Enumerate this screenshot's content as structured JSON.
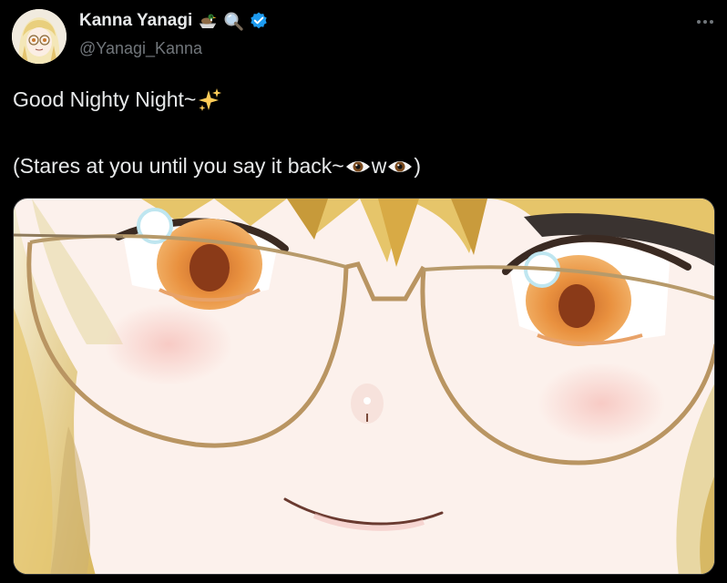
{
  "author": {
    "display_name": "Kanna Yanagi",
    "handle": "@Yanagi_Kanna",
    "name_emojis": [
      "duck-boat-emoji",
      "magnifying-glass-emoji"
    ],
    "verified": true,
    "verified_color": "#1d9bf0"
  },
  "tweet": {
    "line1_text": "Good Nighty Night~",
    "line1_emoji": "sparkles-emoji",
    "line2_prefix": "(Stares at you until you say it back~",
    "line2_mid": "w",
    "line2_suffix": ")",
    "line2_emojis": [
      "eye-emoji",
      "eye-emoji"
    ]
  },
  "media": {
    "type": "image",
    "subject": "anime-girl-closeup-with-round-glasses"
  },
  "colors": {
    "background": "#000000",
    "text": "#e7e9ea",
    "secondary": "#71767b",
    "accent": "#1d9bf0"
  }
}
